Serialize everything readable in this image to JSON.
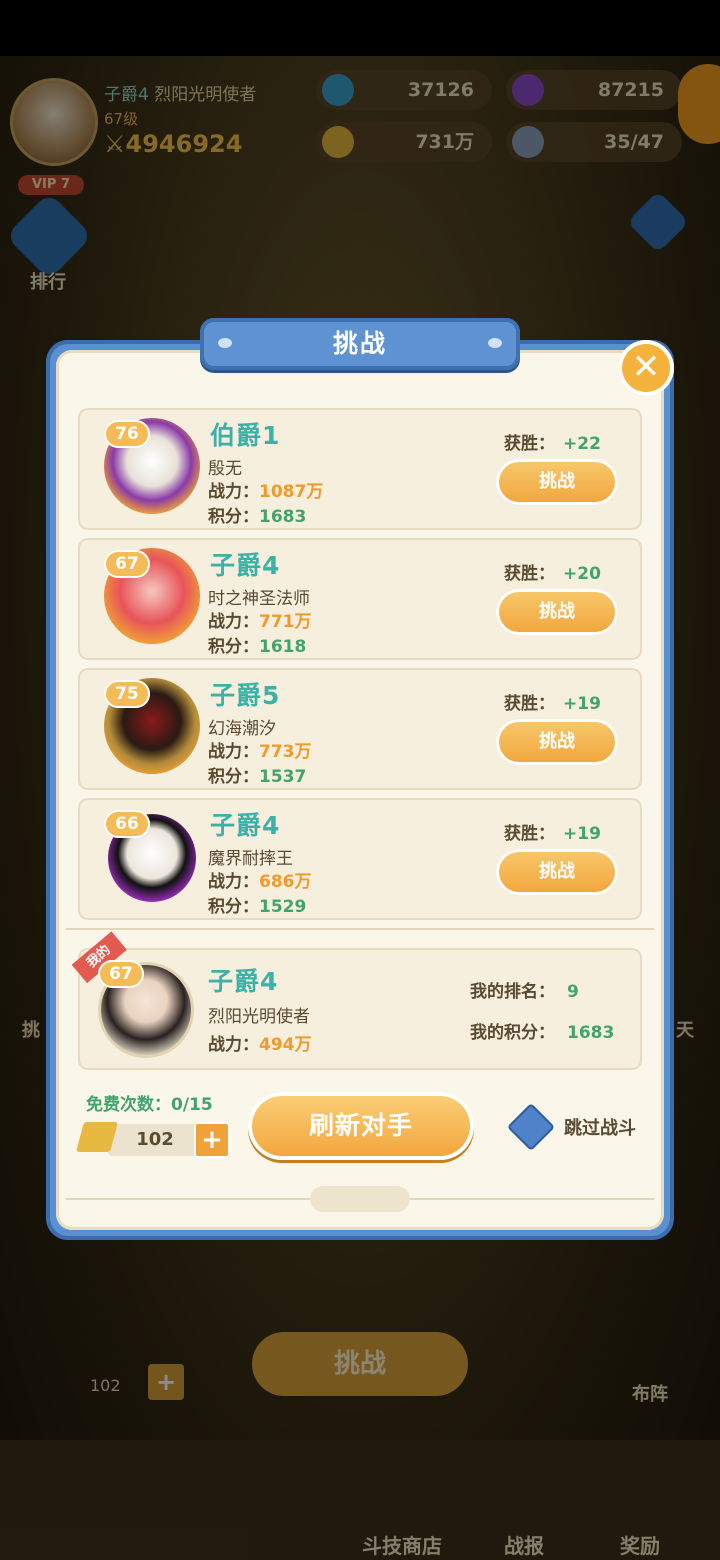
{
  "hud": {
    "player_title": "子爵4",
    "player_name": "烈阳光明使者",
    "level": "67级",
    "power": "4946924",
    "diamonds": "37126",
    "gems": "87215",
    "gold": "731万",
    "friends": "35/47",
    "vip": "VIP 7",
    "rank_label": "排行"
  },
  "background": {
    "challenge_button": "挑战",
    "tickets": "102",
    "formation_label": "布阵",
    "side_left": "挑",
    "side_right": "天"
  },
  "bottom_nav": [
    "斗技商店",
    "战报",
    "奖励"
  ],
  "dialog": {
    "title": "挑战",
    "close": "✕",
    "power_label": "战力：",
    "score_label": "积分：",
    "win_label": "获胜：",
    "challenge_label": "挑战",
    "opponents": [
      {
        "level": "76",
        "rank": "伯爵1",
        "name": "殷无",
        "power": "1087万",
        "score": "1683",
        "win": "+22"
      },
      {
        "level": "67",
        "rank": "子爵4",
        "name": "时之神圣法师",
        "power": "771万",
        "score": "1618",
        "win": "+20"
      },
      {
        "level": "75",
        "rank": "子爵5",
        "name": "幻海潮汐",
        "power": "773万",
        "score": "1537",
        "win": "+19"
      },
      {
        "level": "66",
        "rank": "子爵4",
        "name": "魔界耐摔王",
        "power": "686万",
        "score": "1529",
        "win": "+19"
      }
    ],
    "me": {
      "tag": "我的",
      "level": "67",
      "rank": "子爵4",
      "name": "烈阳光明使者",
      "power": "494万",
      "my_rank_label": "我的排名：",
      "my_rank": "9",
      "my_score_label": "我的积分：",
      "my_score": "1683"
    },
    "free_count": "免费次数：0/15",
    "tickets": "102",
    "plus": "+",
    "refresh": "刷新对手",
    "skip_battle": "跳过战斗"
  }
}
